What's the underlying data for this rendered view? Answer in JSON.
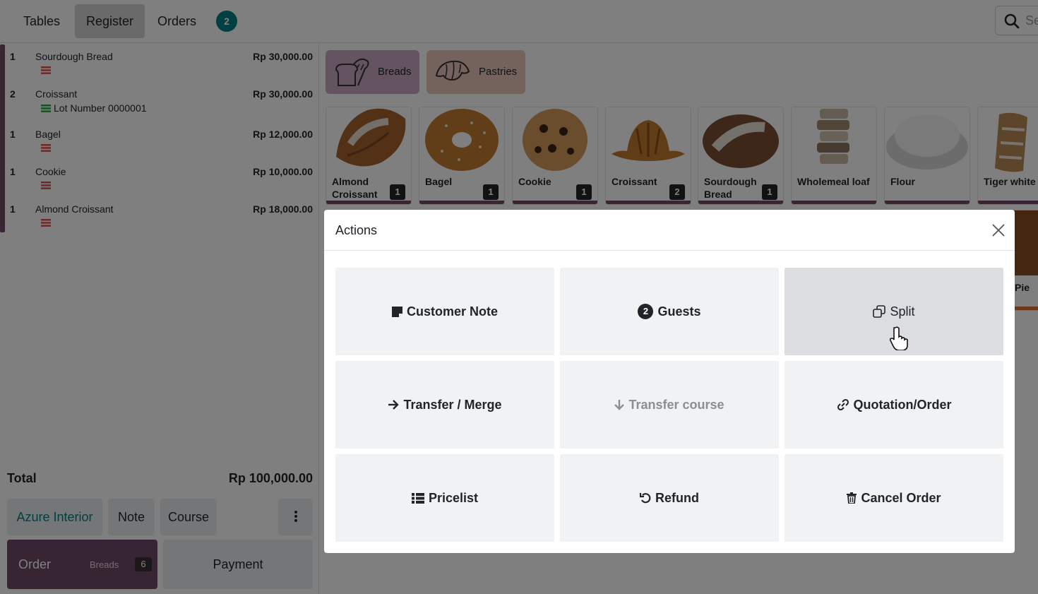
{
  "navbar": {
    "tabs": [
      {
        "label": "Tables"
      },
      {
        "label": "Register"
      },
      {
        "label": "Orders"
      }
    ],
    "orders_count": "2",
    "search_placeholder": "Se"
  },
  "order": {
    "lines": [
      {
        "qty": "1",
        "name": "Sourdough Bread",
        "price": "Rp 30,000.00",
        "lot": ""
      },
      {
        "qty": "2",
        "name": "Croissant",
        "price": "Rp 30,000.00",
        "lot": "Lot Number 0000001"
      },
      {
        "qty": "1",
        "name": "Bagel",
        "price": "Rp 12,000.00",
        "lot": ""
      },
      {
        "qty": "1",
        "name": "Cookie",
        "price": "Rp 10,000.00",
        "lot": ""
      },
      {
        "qty": "1",
        "name": "Almond Croissant",
        "price": "Rp 18,000.00",
        "lot": ""
      }
    ],
    "total_label": "Total",
    "total_value": "Rp 100,000.00",
    "customer": "Azure Interior",
    "note_label": "Note",
    "course_label": "Course",
    "order_label": "Order",
    "order_category": "Breads",
    "order_count": "6",
    "payment_label": "Payment"
  },
  "categories": [
    {
      "label": "Breads",
      "color": "#c9a6c1"
    },
    {
      "label": "Pastries",
      "color": "#e8c6bb"
    }
  ],
  "products": [
    {
      "name": "Almond Croissant",
      "qty": "1"
    },
    {
      "name": "Bagel",
      "qty": "1"
    },
    {
      "name": "Cookie",
      "qty": "1"
    },
    {
      "name": "Croissant",
      "qty": "2"
    },
    {
      "name": "Sourdough Bread",
      "qty": "1"
    },
    {
      "name": "Wholemeal loaf",
      "qty": ""
    },
    {
      "name": "Flour",
      "qty": ""
    },
    {
      "name": "Tiger white l",
      "qty": ""
    }
  ],
  "partial_product_label": "Pie",
  "modal": {
    "title": "Actions",
    "actions": [
      {
        "label": "Customer Note",
        "icon": "note-icon"
      },
      {
        "label": "Guests",
        "icon": "guest-count",
        "count": "2"
      },
      {
        "label": "Split",
        "icon": "copy-icon"
      },
      {
        "label": "Transfer / Merge",
        "icon": "arrow-right-icon"
      },
      {
        "label": "Transfer course",
        "icon": "arrow-down-icon"
      },
      {
        "label": "Quotation/Order",
        "icon": "link-icon"
      },
      {
        "label": "Pricelist",
        "icon": "list-icon"
      },
      {
        "label": "Refund",
        "icon": "undo-icon"
      },
      {
        "label": "Cancel Order",
        "icon": "trash-icon"
      }
    ]
  },
  "colors": {
    "brand": "#714b67",
    "teal": "#017e84",
    "overlay": "rgba(0,0,0,0.5)"
  }
}
